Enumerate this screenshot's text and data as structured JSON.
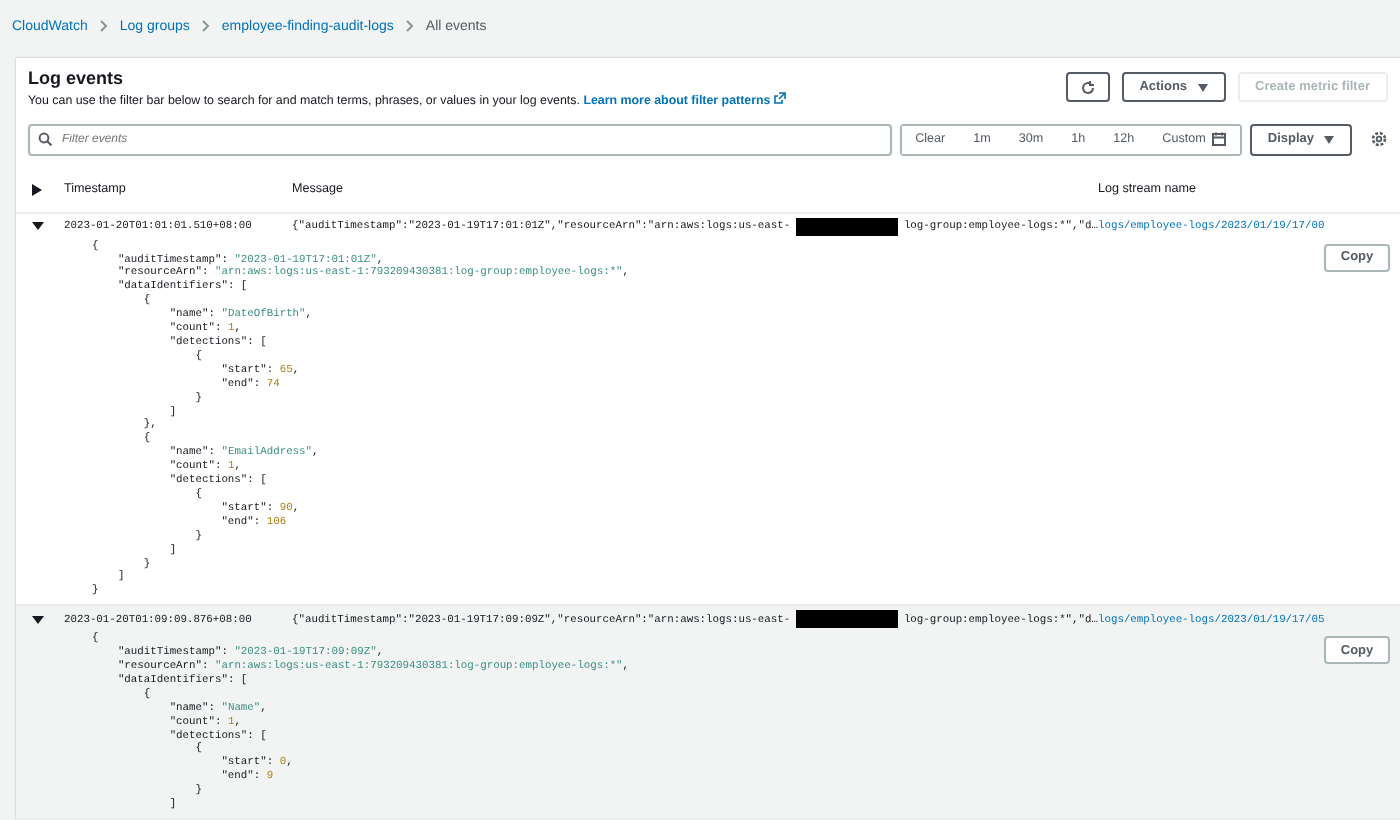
{
  "breadcrumbs": [
    {
      "label": "CloudWatch",
      "link": true
    },
    {
      "label": "Log groups",
      "link": true
    },
    {
      "label": "employee-finding-audit-logs",
      "link": true
    },
    {
      "label": "All events",
      "link": false
    }
  ],
  "header": {
    "title": "Log events",
    "description": "You can use the filter bar below to search for and match terms, phrases, or values in your log events.",
    "learn_more": "Learn more about filter patterns"
  },
  "actions": {
    "label": "Actions"
  },
  "create_metric_filter": {
    "label": "Create metric filter",
    "disabled": true
  },
  "filter": {
    "placeholder": "Filter events"
  },
  "time_ranges": [
    {
      "label": "Clear",
      "selected": false
    },
    {
      "label": "1m",
      "selected": false
    },
    {
      "label": "30m",
      "selected": false
    },
    {
      "label": "1h",
      "selected": false
    },
    {
      "label": "12h",
      "selected": false
    },
    {
      "label": "Custom",
      "selected": false
    }
  ],
  "display": {
    "label": "Display"
  },
  "table": {
    "columns": [
      "Timestamp",
      "Message",
      "Log stream name"
    ],
    "events": [
      {
        "expanded": true,
        "highlighted": false,
        "timestamp": "2023-01-20T01:01:01.510+08:00",
        "message_before": "{\"auditTimestamp\":\"2023-01-19T17:01:01Z\",\"resourceArn\":\"arn:aws:logs:us-east-",
        "redacted": true,
        "message_after": "log-group:employee-logs:*\",\"d…",
        "stream": "logs/employee-logs/2023/01/19/17/00",
        "copy": "Copy",
        "body": [
          [
            {
              "kind": "punct",
              "text": "{"
            }
          ],
          [
            {
              "kind": "key",
              "text": "    \"auditTimestamp\""
            },
            {
              "kind": "punct",
              "text": ": "
            },
            {
              "kind": "string",
              "text": "\"2023-01-19T17:01:01Z\""
            },
            {
              "kind": "punct",
              "text": ","
            }
          ],
          [
            {
              "kind": "key",
              "text": "    \"resourceArn\""
            },
            {
              "kind": "punct",
              "text": ": "
            },
            {
              "kind": "string",
              "text": "\"arn:aws:logs:us-east-1:793209430381:log-group:employee-logs:*\""
            },
            {
              "kind": "punct",
              "text": ","
            }
          ],
          [
            {
              "kind": "key",
              "text": "    \"dataIdentifiers\""
            },
            {
              "kind": "punct",
              "text": ": ["
            }
          ],
          [
            {
              "kind": "punct",
              "text": "        {"
            }
          ],
          [
            {
              "kind": "key",
              "text": "            \"name\""
            },
            {
              "kind": "punct",
              "text": ": "
            },
            {
              "kind": "string",
              "text": "\"DateOfBirth\""
            },
            {
              "kind": "punct",
              "text": ","
            }
          ],
          [
            {
              "kind": "key",
              "text": "            \"count\""
            },
            {
              "kind": "punct",
              "text": ": "
            },
            {
              "kind": "number",
              "text": "1"
            },
            {
              "kind": "punct",
              "text": ","
            }
          ],
          [
            {
              "kind": "key",
              "text": "            \"detections\""
            },
            {
              "kind": "punct",
              "text": ": ["
            }
          ],
          [
            {
              "kind": "punct",
              "text": "                {"
            }
          ],
          [
            {
              "kind": "key",
              "text": "                    \"start\""
            },
            {
              "kind": "punct",
              "text": ": "
            },
            {
              "kind": "number",
              "text": "65"
            },
            {
              "kind": "punct",
              "text": ","
            }
          ],
          [
            {
              "kind": "key",
              "text": "                    \"end\""
            },
            {
              "kind": "punct",
              "text": ": "
            },
            {
              "kind": "number",
              "text": "74"
            }
          ],
          [
            {
              "kind": "punct",
              "text": "                }"
            }
          ],
          [
            {
              "kind": "punct",
              "text": "            ]"
            }
          ],
          [
            {
              "kind": "punct",
              "text": "        },"
            }
          ],
          [
            {
              "kind": "punct",
              "text": "        {"
            }
          ],
          [
            {
              "kind": "key",
              "text": "            \"name\""
            },
            {
              "kind": "punct",
              "text": ": "
            },
            {
              "kind": "string",
              "text": "\"EmailAddress\""
            },
            {
              "kind": "punct",
              "text": ","
            }
          ],
          [
            {
              "kind": "key",
              "text": "            \"count\""
            },
            {
              "kind": "punct",
              "text": ": "
            },
            {
              "kind": "number",
              "text": "1"
            },
            {
              "kind": "punct",
              "text": ","
            }
          ],
          [
            {
              "kind": "key",
              "text": "            \"detections\""
            },
            {
              "kind": "punct",
              "text": ": ["
            }
          ],
          [
            {
              "kind": "punct",
              "text": "                {"
            }
          ],
          [
            {
              "kind": "key",
              "text": "                    \"start\""
            },
            {
              "kind": "punct",
              "text": ": "
            },
            {
              "kind": "number",
              "text": "90"
            },
            {
              "kind": "punct",
              "text": ","
            }
          ],
          [
            {
              "kind": "key",
              "text": "                    \"end\""
            },
            {
              "kind": "punct",
              "text": ": "
            },
            {
              "kind": "number",
              "text": "106"
            }
          ],
          [
            {
              "kind": "punct",
              "text": "                }"
            }
          ],
          [
            {
              "kind": "punct",
              "text": "            ]"
            }
          ],
          [
            {
              "kind": "punct",
              "text": "        }"
            }
          ],
          [
            {
              "kind": "punct",
              "text": "    ]"
            }
          ],
          [
            {
              "kind": "punct",
              "text": "}"
            }
          ]
        ]
      },
      {
        "expanded": true,
        "highlighted": true,
        "timestamp": "2023-01-20T01:09:09.876+08:00",
        "message_before": "{\"auditTimestamp\":\"2023-01-19T17:09:09Z\",\"resourceArn\":\"arn:aws:logs:us-east-",
        "redacted": true,
        "message_after": "log-group:employee-logs:*\",\"d…",
        "stream": "logs/employee-logs/2023/01/19/17/05",
        "copy": "Copy",
        "body": [
          [
            {
              "kind": "punct",
              "text": "{"
            }
          ],
          [
            {
              "kind": "key",
              "text": "    \"auditTimestamp\""
            },
            {
              "kind": "punct",
              "text": ": "
            },
            {
              "kind": "string",
              "text": "\"2023-01-19T17:09:09Z\""
            },
            {
              "kind": "punct",
              "text": ","
            }
          ],
          [
            {
              "kind": "key",
              "text": "    \"resourceArn\""
            },
            {
              "kind": "punct",
              "text": ": "
            },
            {
              "kind": "string",
              "text": "\"arn:aws:logs:us-east-1:793209430381:log-group:employee-logs:*\""
            },
            {
              "kind": "punct",
              "text": ","
            }
          ],
          [
            {
              "kind": "key",
              "text": "    \"dataIdentifiers\""
            },
            {
              "kind": "punct",
              "text": ": ["
            }
          ],
          [
            {
              "kind": "punct",
              "text": "        {"
            }
          ],
          [
            {
              "kind": "key",
              "text": "            \"name\""
            },
            {
              "kind": "punct",
              "text": ": "
            },
            {
              "kind": "string",
              "text": "\"Name\""
            },
            {
              "kind": "punct",
              "text": ","
            }
          ],
          [
            {
              "kind": "key",
              "text": "            \"count\""
            },
            {
              "kind": "punct",
              "text": ": "
            },
            {
              "kind": "number",
              "text": "1"
            },
            {
              "kind": "punct",
              "text": ","
            }
          ],
          [
            {
              "kind": "key",
              "text": "            \"detections\""
            },
            {
              "kind": "punct",
              "text": ": ["
            }
          ],
          [
            {
              "kind": "punct",
              "text": "                {"
            }
          ],
          [
            {
              "kind": "key",
              "text": "                    \"start\""
            },
            {
              "kind": "punct",
              "text": ": "
            },
            {
              "kind": "number",
              "text": "0"
            },
            {
              "kind": "punct",
              "text": ","
            }
          ],
          [
            {
              "kind": "key",
              "text": "                    \"end\""
            },
            {
              "kind": "punct",
              "text": ": "
            },
            {
              "kind": "number",
              "text": "9"
            }
          ],
          [
            {
              "kind": "punct",
              "text": "                }"
            }
          ],
          [
            {
              "kind": "punct",
              "text": "            ]"
            }
          ]
        ]
      }
    ]
  }
}
